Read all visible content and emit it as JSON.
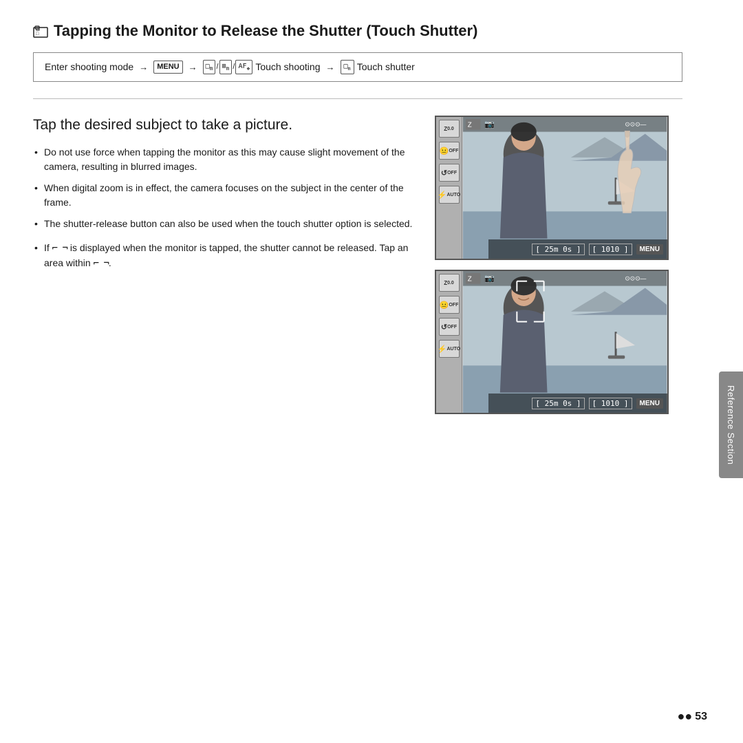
{
  "page": {
    "title": "Tapping the Monitor to Release the Shutter (Touch Shutter)",
    "title_icon": "🔲",
    "nav": {
      "text_before": "Enter shooting mode",
      "arrow1": "→",
      "icon_menu": "MENU",
      "arrow2": "→",
      "icon_modes": "□/□/□",
      "text_middle": "Touch shooting",
      "arrow3": "→",
      "icon_touch": "□",
      "text_end": "Touch shutter"
    },
    "section_heading": "Tap the desired subject to take a picture.",
    "bullets": [
      "Do not use force when tapping the monitor as this may cause slight movement of the camera, resulting in blurred images.",
      "When digital zoom is in effect, the camera focuses on the subject in the center of the frame.",
      "The shutter-release button can also be used when the touch shutter option is selected."
    ],
    "extra_note": "is displayed when the monitor is tapped, the shutter cannot be released. Tap an area within",
    "reference_label": "Reference Section",
    "page_number": "53",
    "camera_screens": [
      {
        "id": "screen1",
        "timer": "[ 25m 0s ]",
        "counter": "[ 1010 ]",
        "menu_label": "MENU",
        "has_finger": true
      },
      {
        "id": "screen2",
        "timer": "[ 25m 0s ]",
        "counter": "[ 1010 ]",
        "menu_label": "MENU",
        "has_finger": false
      }
    ],
    "sidebar_icons": [
      {
        "label": "Z\n0.0"
      },
      {
        "label": "⬜\nOFF"
      },
      {
        "label": "↻\nOFF"
      },
      {
        "label": "⚡\nAUTO"
      }
    ]
  }
}
